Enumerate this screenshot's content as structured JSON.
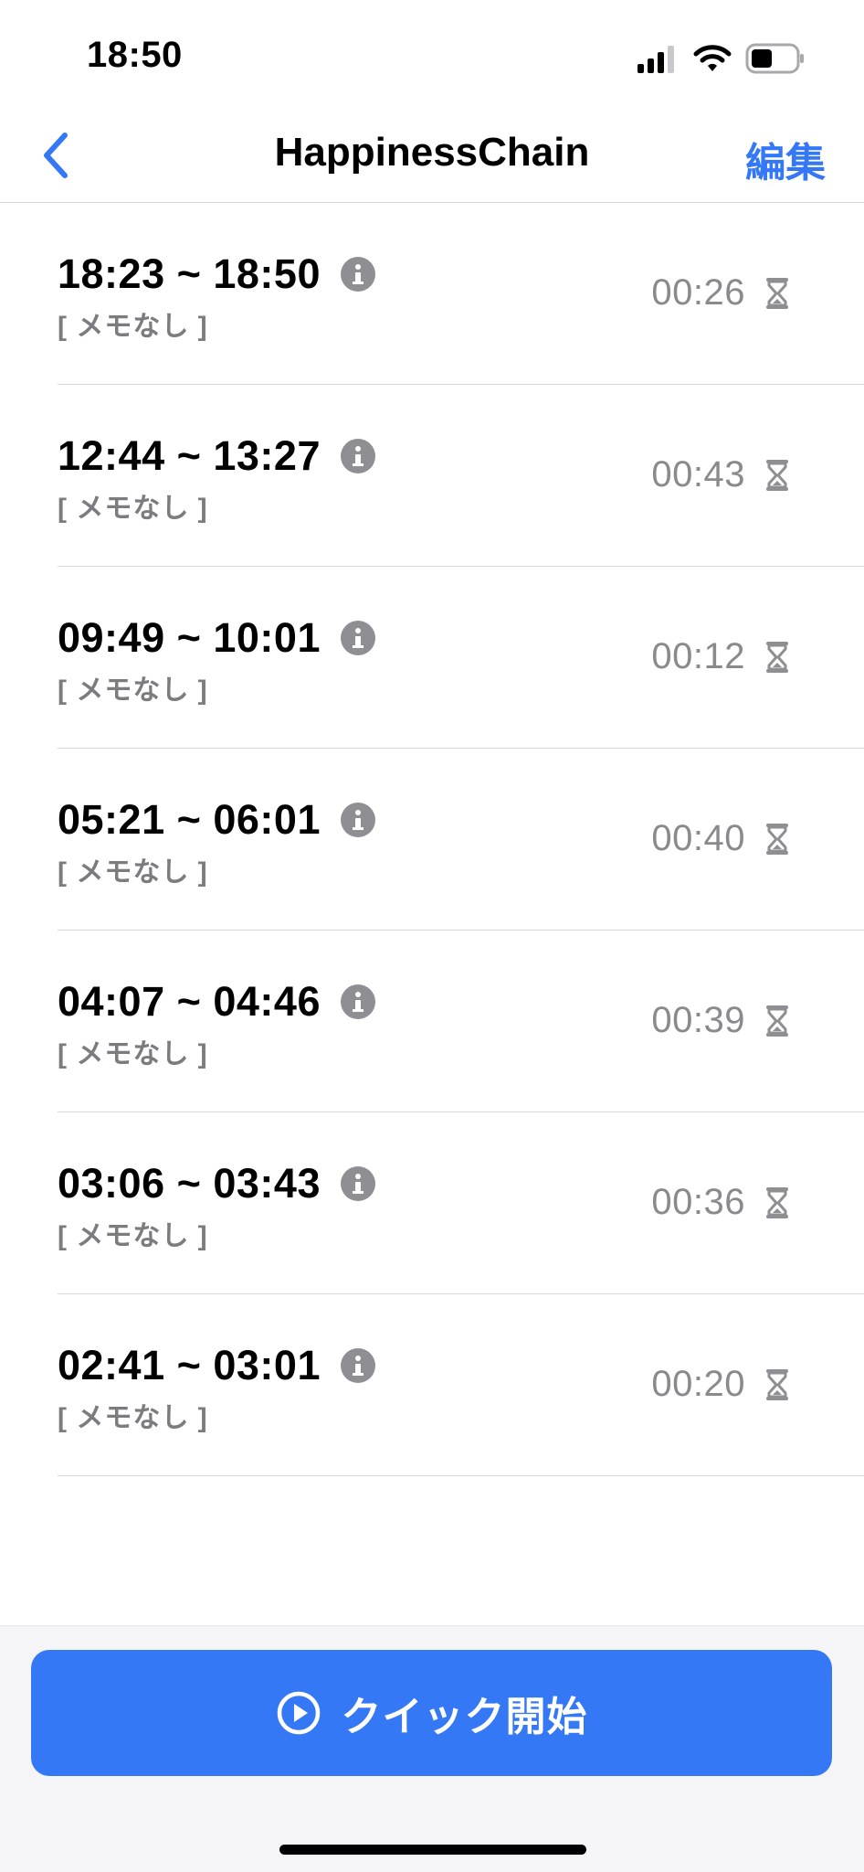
{
  "status_bar": {
    "time": "18:50"
  },
  "nav": {
    "title": "HappinessChain",
    "edit_label": "編集"
  },
  "sessions": [
    {
      "range": "18:23 ~ 18:50",
      "memo": "[ メモなし ]",
      "duration": "00:26"
    },
    {
      "range": "12:44 ~ 13:27",
      "memo": "[ メモなし ]",
      "duration": "00:43"
    },
    {
      "range": "09:49 ~ 10:01",
      "memo": "[ メモなし ]",
      "duration": "00:12"
    },
    {
      "range": "05:21 ~ 06:01",
      "memo": "[ メモなし ]",
      "duration": "00:40"
    },
    {
      "range": "04:07 ~ 04:46",
      "memo": "[ メモなし ]",
      "duration": "00:39"
    },
    {
      "range": "03:06 ~ 03:43",
      "memo": "[ メモなし ]",
      "duration": "00:36"
    },
    {
      "range": "02:41 ~ 03:01",
      "memo": "[ メモなし ]",
      "duration": "00:20"
    }
  ],
  "quick_start": {
    "label": "クイック開始"
  },
  "colors": {
    "accent": "#3478f6",
    "icon_gray": "#8e8e93",
    "secondary_text": "#8a8a8e"
  },
  "icons": {
    "back": "chevron-left-icon",
    "info": "info-icon",
    "duration": "hourglass-icon",
    "play": "play-circle-icon"
  }
}
